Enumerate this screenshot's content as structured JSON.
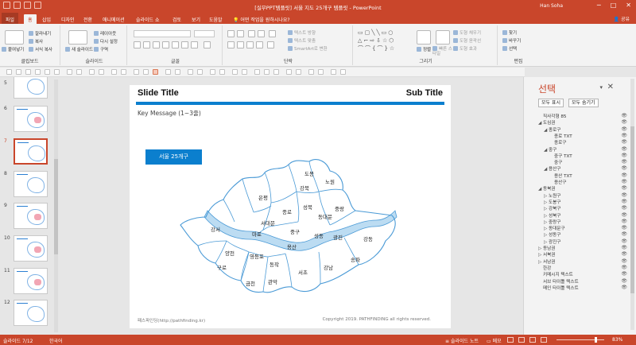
{
  "window": {
    "title": "[실무PPT템플릿] 서울 지도 25개구 템플릿 - PowerPoint",
    "user": "Han Soha",
    "controls": [
      "─",
      "□",
      "✕"
    ]
  },
  "tabs": {
    "file": "파일",
    "items": [
      "홈",
      "삽입",
      "디자인",
      "전환",
      "애니메이션",
      "슬라이드 쇼",
      "검토",
      "보기",
      "도움말"
    ],
    "tell_me": "어떤 작업을 원하시나요?",
    "share": "공유"
  },
  "ribbon": {
    "clipboard": {
      "label": "클립보드",
      "paste": "붙여넣기",
      "cut": "잘라내기",
      "copy": "복사",
      "format_painter": "서식 복사"
    },
    "slides": {
      "label": "슬라이드",
      "new_slide": "새 슬라이드",
      "layout": "레이아웃",
      "reset": "다시 설정",
      "section": "구역"
    },
    "font": {
      "label": "글꼴"
    },
    "paragraph": {
      "label": "단락",
      "text_direction": "텍스트 방향",
      "align_text": "텍스트 맞춤",
      "smartart": "SmartArt로 변환"
    },
    "drawing": {
      "label": "그리기",
      "arrange": "정렬",
      "quick_styles": "빠른 스타일",
      "fill": "도형 채우기",
      "outline": "도형 윤곽선",
      "effects": "도형 효과"
    },
    "editing": {
      "label": "편집",
      "find": "찾기",
      "replace": "바꾸기",
      "select": "선택"
    }
  },
  "thumbnails": {
    "numbers": [
      "5",
      "6",
      "7",
      "8",
      "9",
      "10",
      "11",
      "12"
    ],
    "selected": "7"
  },
  "slide": {
    "title": "Slide Title",
    "subtitle": "Sub Title",
    "key_message": "Key Message (1~3줄)",
    "button": "서울 25개구",
    "footer": "패스파인딩(http://pathfinding.kr)",
    "copyright": "Copyright 2019. PATHFINDING all rights reserved."
  },
  "districts": {
    "dobong": "도봉",
    "nowon": "노원",
    "gangbuk": "강북",
    "eunpyeong": "은평",
    "seongbuk": "성북",
    "jongno": "종로",
    "jungnang": "중랑",
    "dongdaemun": "동대문",
    "seodaemun": "서대문",
    "junggu": "중구",
    "gangseo": "강서",
    "mapo": "마포",
    "seongdong": "성동",
    "gwangjin": "광진",
    "gangdong": "강동",
    "yongsan": "용산",
    "yangcheon": "양천",
    "yeongdeungpo": "영등포",
    "songpa": "송파",
    "guro": "구로",
    "dongjak": "동작",
    "gangnam": "강남",
    "seocho": "서초",
    "geumcheon": "금천",
    "gwanak": "관악"
  },
  "selection_pane": {
    "title": "선택",
    "show_all": "모두 표시",
    "hide_all": "모두 숨기기",
    "items": [
      {
        "indent": 0,
        "arrow": "",
        "label": "직사각형 85"
      },
      {
        "indent": 0,
        "arrow": "◢",
        "label": "도심권"
      },
      {
        "indent": 1,
        "arrow": "◢",
        "label": "종로구"
      },
      {
        "indent": 2,
        "arrow": "",
        "label": "종로 TXT"
      },
      {
        "indent": 2,
        "arrow": "",
        "label": "종로구"
      },
      {
        "indent": 1,
        "arrow": "◢",
        "label": "중구"
      },
      {
        "indent": 2,
        "arrow": "",
        "label": "중구 TXT"
      },
      {
        "indent": 2,
        "arrow": "",
        "label": "중구"
      },
      {
        "indent": 1,
        "arrow": "◢",
        "label": "용산구"
      },
      {
        "indent": 2,
        "arrow": "",
        "label": "용산 TXT"
      },
      {
        "indent": 2,
        "arrow": "",
        "label": "용산구"
      },
      {
        "indent": 0,
        "arrow": "◢",
        "label": "동북권"
      },
      {
        "indent": 1,
        "arrow": "▷",
        "label": "노원구"
      },
      {
        "indent": 1,
        "arrow": "▷",
        "label": "도봉구"
      },
      {
        "indent": 1,
        "arrow": "▷",
        "label": "강북구"
      },
      {
        "indent": 1,
        "arrow": "▷",
        "label": "성북구"
      },
      {
        "indent": 1,
        "arrow": "▷",
        "label": "중랑구"
      },
      {
        "indent": 1,
        "arrow": "▷",
        "label": "동대문구"
      },
      {
        "indent": 1,
        "arrow": "▷",
        "label": "성동구"
      },
      {
        "indent": 1,
        "arrow": "▷",
        "label": "광진구"
      },
      {
        "indent": 0,
        "arrow": "▷",
        "label": "동남권"
      },
      {
        "indent": 0,
        "arrow": "▷",
        "label": "서북권"
      },
      {
        "indent": 0,
        "arrow": "▷",
        "label": "서남권"
      },
      {
        "indent": 0,
        "arrow": "",
        "label": "한강"
      },
      {
        "indent": 0,
        "arrow": "",
        "label": "키메시지 텍스트"
      },
      {
        "indent": 0,
        "arrow": "",
        "label": "서브 타이틀 텍스트"
      },
      {
        "indent": 0,
        "arrow": "",
        "label": "메인 타이틀 텍스트"
      }
    ]
  },
  "status": {
    "slide_indicator": "슬라이드 7/12",
    "language": "한국어",
    "notes": "슬라이드 노트",
    "memo": "메모",
    "zoom": "83%"
  },
  "colors": {
    "accent": "#c9462b",
    "slide_blue": "#0b7fce",
    "map_line": "#4a9ad6",
    "river": "#bcdcf2"
  },
  "icons": {
    "eye": "👁",
    "search": "⌕",
    "close": "✕"
  }
}
